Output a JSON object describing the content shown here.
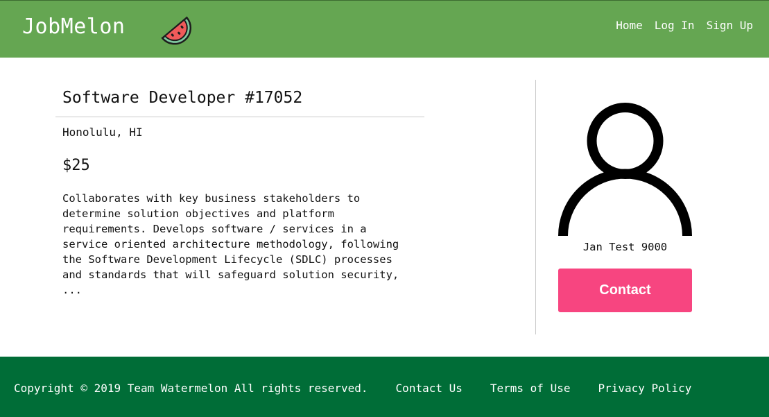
{
  "header": {
    "brand": "JobMelon",
    "logo_icon": "watermelon-slice-icon",
    "nav": [
      {
        "label": "Home"
      },
      {
        "label": "Log In"
      },
      {
        "label": "Sign Up"
      }
    ],
    "background_color": "#65a652"
  },
  "job": {
    "title": "Software Developer #17052",
    "location": "Honolulu, HI",
    "pay": "$25",
    "description": "Collaborates with key business stakeholders to\ndetermine solution objectives and platform\nrequirements. Develops software / services in a\nservice oriented architecture methodology, following\nthe Software Development Lifecycle (SDLC) processes\nand standards that will safeguard solution security,\n..."
  },
  "poster": {
    "avatar_icon": "user-avatar-icon",
    "name": "Jan Test 9000",
    "contact_label": "Contact",
    "contact_color": "#f74580"
  },
  "footer": {
    "copyright": "Copyright © 2019 Team Watermelon All rights reserved.",
    "links": [
      {
        "label": "Contact Us"
      },
      {
        "label": "Terms of Use"
      },
      {
        "label": "Privacy Policy"
      }
    ],
    "background_color": "#006d37"
  }
}
